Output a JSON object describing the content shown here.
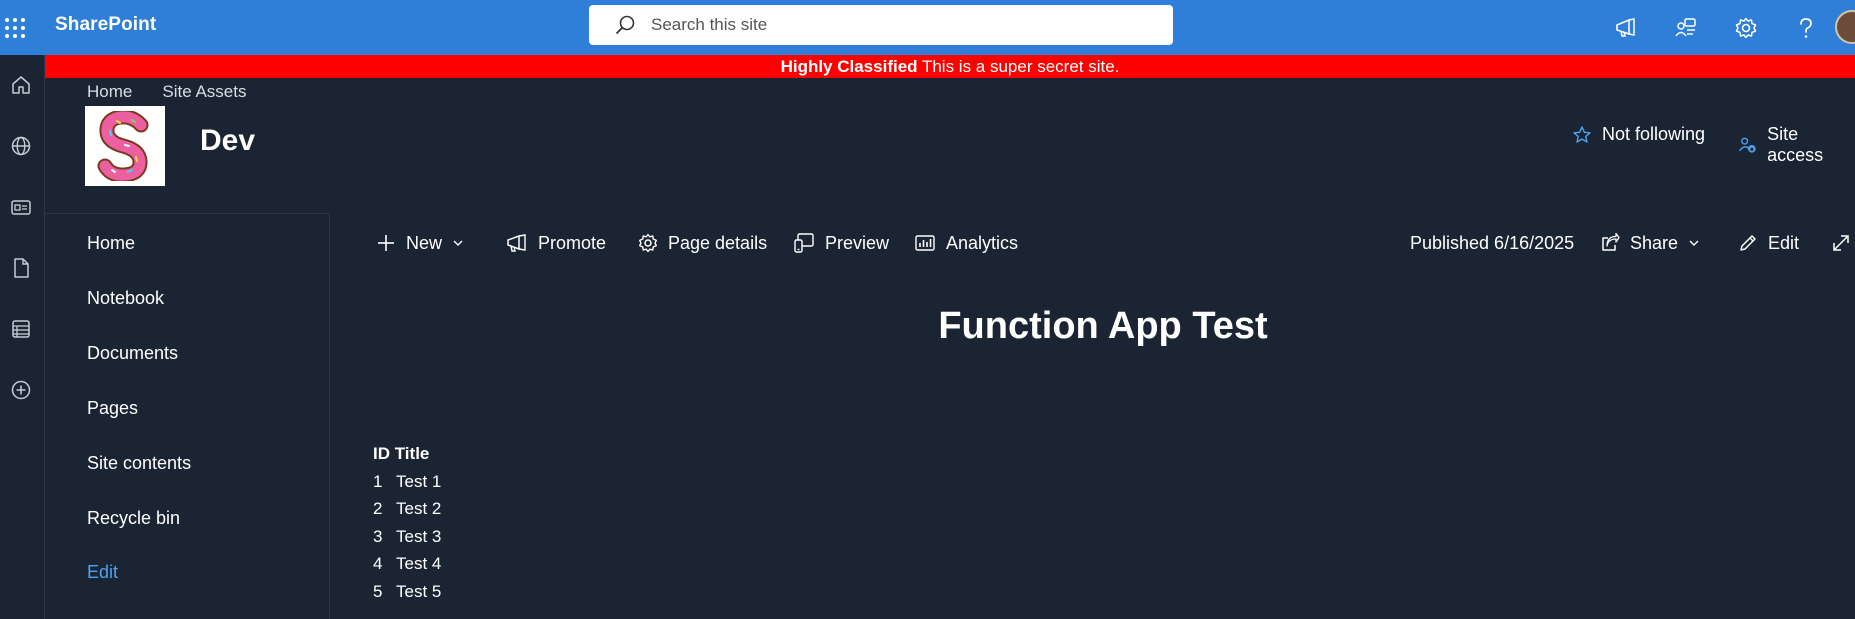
{
  "suitebar": {
    "app_name": "SharePoint",
    "search_placeholder": "Search this site",
    "icons": [
      "waffle-icon",
      "megaphone-icon",
      "people-icon",
      "gear-icon",
      "help-icon"
    ],
    "bg_color": "#2f7ed8"
  },
  "rail": {
    "items": [
      "home-icon",
      "globe-icon",
      "news-icon",
      "document-icon",
      "list-icon",
      "add-icon"
    ]
  },
  "banner": {
    "label": "Highly Classified",
    "text": " This is a super secret site.",
    "color": "#ff0000"
  },
  "site": {
    "breadcrumbs": [
      "Home",
      "Site Assets"
    ],
    "logo_letter": "S",
    "title": "Dev",
    "follow_label": "Not following",
    "access_label": "Site access"
  },
  "leftnav": {
    "items": [
      "Home",
      "Notebook",
      "Documents",
      "Pages",
      "Site contents",
      "Recycle bin"
    ],
    "edit_label": "Edit"
  },
  "commandbar": {
    "new_label": "New",
    "promote_label": "Promote",
    "page_details_label": "Page details",
    "preview_label": "Preview",
    "analytics_label": "Analytics",
    "published_label": "Published 6/16/2025",
    "share_label": "Share",
    "edit_label": "Edit"
  },
  "page": {
    "title": "Function App Test",
    "table": {
      "headers": [
        "ID",
        "Title"
      ],
      "rows": [
        {
          "id": "1",
          "title": "Test 1"
        },
        {
          "id": "2",
          "title": "Test 2"
        },
        {
          "id": "3",
          "title": "Test 3"
        },
        {
          "id": "4",
          "title": "Test 4"
        },
        {
          "id": "5",
          "title": "Test 5"
        }
      ]
    }
  }
}
